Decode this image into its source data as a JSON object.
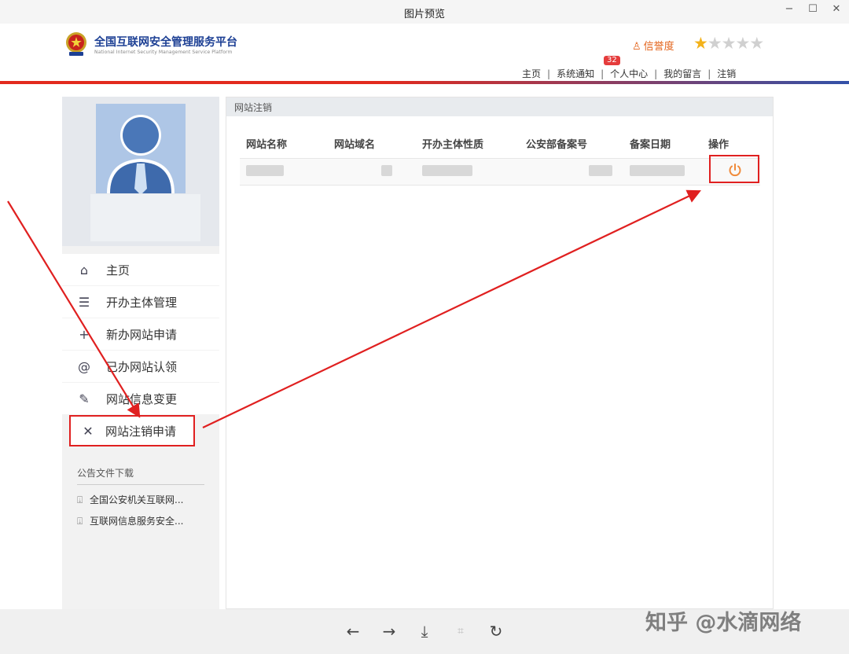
{
  "window": {
    "title": "图片预览",
    "minimize": "−",
    "maximize": "☐",
    "close": "✕"
  },
  "header": {
    "brand_cn": "全国互联网安全管理服务平台",
    "brand_en": "National Internet Security Management Service Platform",
    "credit_label": "信誉度",
    "credit_rating": 1,
    "credit_max": 5,
    "nav": [
      {
        "label": "主页"
      },
      {
        "label": "系统通知",
        "badge": "32"
      },
      {
        "label": "个人中心"
      },
      {
        "label": "我的留言"
      },
      {
        "label": "注销"
      }
    ]
  },
  "sidebar": {
    "menu": [
      {
        "icon": "home-icon",
        "glyph": "⌂",
        "label": "主页"
      },
      {
        "icon": "list-icon",
        "glyph": "☰",
        "label": "开办主体管理"
      },
      {
        "icon": "plus-icon",
        "glyph": "+",
        "label": "新办网站申请"
      },
      {
        "icon": "at-icon",
        "glyph": "@",
        "label": "已办网站认领"
      },
      {
        "icon": "edit-icon",
        "glyph": "✎",
        "label": "网站信息变更"
      },
      {
        "icon": "close-icon",
        "glyph": "✕",
        "label": "网站注销申请"
      }
    ],
    "downloads_title": "公告文件下载",
    "downloads": [
      {
        "label": "全国公安机关互联网..."
      },
      {
        "label": "互联网信息服务安全..."
      }
    ]
  },
  "content": {
    "section_title": "网站注销",
    "columns": [
      "网站名称",
      "网站域名",
      "开办主体性质",
      "公安部备案号",
      "备案日期",
      "操作"
    ]
  },
  "bottombar": {
    "prev": "←",
    "next": "→",
    "download": "⤓",
    "fit": "⌗",
    "rotate": "↻"
  },
  "watermark": "知乎 @水滴网络",
  "colors": {
    "accent_red": "#e22a1d",
    "accent_blue": "#3251a8",
    "brand": "#1c3f94",
    "credit": "#e3631a",
    "star": "#f3b21b",
    "annotation": "#e02020"
  }
}
